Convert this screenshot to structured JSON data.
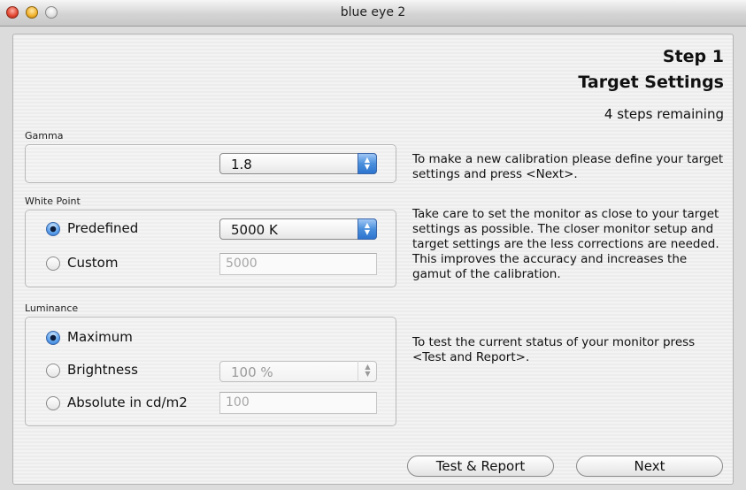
{
  "window": {
    "title": "blue eye 2"
  },
  "header": {
    "step": "Step 1",
    "subtitle": "Target Settings",
    "remaining": "4 steps remaining"
  },
  "gamma": {
    "label": "Gamma",
    "value": "1.8"
  },
  "white_point": {
    "label": "White Point",
    "predefined_label": "Predefined",
    "predefined_value": "5000 K",
    "custom_label": "Custom",
    "custom_value": "5000",
    "selected": "Predefined"
  },
  "luminance": {
    "label": "Luminance",
    "maximum_label": "Maximum",
    "brightness_label": "Brightness",
    "brightness_value": "100 %",
    "absolute_label": "Absolute in cd/m2",
    "absolute_value": "100",
    "selected": "Maximum"
  },
  "description": {
    "p1": "To make a new calibration please define your target settings and press <Next>.",
    "p2": "Take care to set the monitor as close to your target settings as possible. The closer monitor setup and target settings are the less corrections are needed. This improves the accuracy and increases the gamut of the calibration.",
    "p3": "To test the current status of your monitor press <Test and Report>."
  },
  "buttons": {
    "test_report": "Test & Report",
    "next": "Next"
  },
  "icons": {
    "popup_arrows": "up-down-arrows-icon",
    "close": "close-icon",
    "minimize": "minimize-icon",
    "zoom": "zoom-icon"
  },
  "colors": {
    "accent": "#3d86dc",
    "window_bg": "#ececec"
  }
}
